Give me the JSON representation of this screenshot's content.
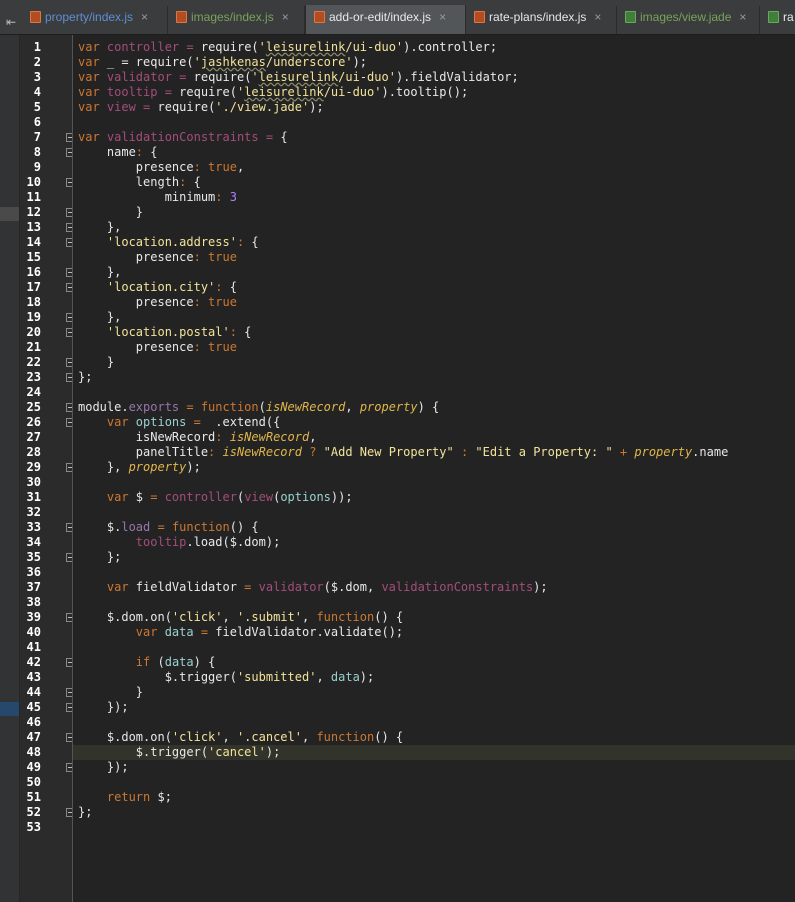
{
  "tabs": [
    {
      "label": "property/index.js",
      "icon": "js-file-icon",
      "color": "#5e8fd6",
      "closable": true,
      "active": false
    },
    {
      "label": "images/index.js",
      "icon": "js-file-icon",
      "color": "#7aa35a",
      "closable": true,
      "active": false
    },
    {
      "label": "add-or-edit/index.js",
      "icon": "js-file-icon",
      "color": "#e8e8e8",
      "closable": true,
      "active": true
    },
    {
      "label": "rate-plans/index.js",
      "icon": "js-file-icon",
      "color": "#e8e8e8",
      "closable": true,
      "active": false
    },
    {
      "label": "images/view.jade",
      "icon": "jade-file-icon",
      "color": "#7aa35a",
      "closable": true,
      "active": false
    },
    {
      "label": "ra",
      "icon": "jade-file-icon",
      "color": "#e8e8e8",
      "closable": false,
      "active": false
    }
  ],
  "tab_scroll_glyph": "⇤",
  "close_glyph": "×",
  "editor": {
    "current_line": 48,
    "lines": [
      {
        "n": "1",
        "t": [
          [
            "kw",
            "var "
          ],
          [
            "gvar",
            "controller"
          ],
          [
            "gvar",
            " = "
          ],
          [
            "plain",
            "require("
          ],
          [
            "str",
            "'"
          ],
          [
            "str und",
            "leisurelink"
          ],
          [
            "str",
            "/ui-duo'"
          ],
          [
            "plain",
            ").controller;"
          ]
        ]
      },
      {
        "n": "2",
        "t": [
          [
            "kw",
            "var "
          ],
          [
            "plain",
            "_ = require("
          ],
          [
            "str",
            "'"
          ],
          [
            "str und",
            "jashkenas"
          ],
          [
            "str",
            "/underscore'"
          ],
          [
            "plain",
            ");"
          ]
        ]
      },
      {
        "n": "3",
        "t": [
          [
            "kw",
            "var "
          ],
          [
            "gvar",
            "validator"
          ],
          [
            "gvar",
            " = "
          ],
          [
            "plain",
            "require("
          ],
          [
            "str",
            "'"
          ],
          [
            "str und",
            "leisurelink"
          ],
          [
            "str",
            "/ui-duo'"
          ],
          [
            "plain",
            ").fieldValidator;"
          ]
        ]
      },
      {
        "n": "4",
        "t": [
          [
            "kw",
            "var "
          ],
          [
            "gvar",
            "tooltip"
          ],
          [
            "gvar",
            " = "
          ],
          [
            "plain",
            "require("
          ],
          [
            "str",
            "'"
          ],
          [
            "str und",
            "leisurelink"
          ],
          [
            "str",
            "/ui-duo'"
          ],
          [
            "plain",
            ").tooltip();"
          ]
        ]
      },
      {
        "n": "5",
        "t": [
          [
            "kw",
            "var "
          ],
          [
            "gvar",
            "view"
          ],
          [
            "gvar",
            " = "
          ],
          [
            "plain",
            "require("
          ],
          [
            "str",
            "'./view.jade'"
          ],
          [
            "plain",
            ");"
          ]
        ]
      },
      {
        "n": "6",
        "t": []
      },
      {
        "n": "7",
        "t": [
          [
            "kw",
            "var "
          ],
          [
            "gvar",
            "validationConstraints"
          ],
          [
            "gvar",
            " = "
          ],
          [
            "plain",
            "{"
          ]
        ]
      },
      {
        "n": "8",
        "t": [
          [
            "plain",
            "    name"
          ],
          [
            "kw",
            ": "
          ],
          [
            "plain",
            "{"
          ]
        ]
      },
      {
        "n": "9",
        "t": [
          [
            "plain",
            "        presence"
          ],
          [
            "kw",
            ": true"
          ],
          [
            "plain",
            ","
          ]
        ]
      },
      {
        "n": "10",
        "t": [
          [
            "plain",
            "        length"
          ],
          [
            "kw",
            ": "
          ],
          [
            "plain",
            "{"
          ]
        ]
      },
      {
        "n": "11",
        "t": [
          [
            "plain",
            "            minimum"
          ],
          [
            "kw",
            ": "
          ],
          [
            "num",
            "3"
          ]
        ]
      },
      {
        "n": "12",
        "t": [
          [
            "plain",
            "        }"
          ]
        ]
      },
      {
        "n": "13",
        "t": [
          [
            "plain",
            "    },"
          ]
        ]
      },
      {
        "n": "14",
        "t": [
          [
            "str",
            "    'location.address'"
          ],
          [
            "kw",
            ": "
          ],
          [
            "plain",
            "{"
          ]
        ]
      },
      {
        "n": "15",
        "t": [
          [
            "plain",
            "        presence"
          ],
          [
            "kw",
            ": true"
          ]
        ]
      },
      {
        "n": "16",
        "t": [
          [
            "plain",
            "    },"
          ]
        ]
      },
      {
        "n": "17",
        "t": [
          [
            "str",
            "    'location.city'"
          ],
          [
            "kw",
            ": "
          ],
          [
            "plain",
            "{"
          ]
        ]
      },
      {
        "n": "18",
        "t": [
          [
            "plain",
            "        presence"
          ],
          [
            "kw",
            ": true"
          ]
        ]
      },
      {
        "n": "19",
        "t": [
          [
            "plain",
            "    },"
          ]
        ]
      },
      {
        "n": "20",
        "t": [
          [
            "str",
            "    'location.postal'"
          ],
          [
            "kw",
            ": "
          ],
          [
            "plain",
            "{"
          ]
        ]
      },
      {
        "n": "21",
        "t": [
          [
            "plain",
            "        presence"
          ],
          [
            "kw",
            ": true"
          ]
        ]
      },
      {
        "n": "22",
        "t": [
          [
            "plain",
            "    }"
          ]
        ]
      },
      {
        "n": "23",
        "t": [
          [
            "plain",
            "};"
          ]
        ]
      },
      {
        "n": "24",
        "t": []
      },
      {
        "n": "25",
        "t": [
          [
            "plain",
            "module."
          ],
          [
            "fld",
            "exports"
          ],
          [
            "kw",
            " = function"
          ],
          [
            "plain",
            "("
          ],
          [
            "par",
            "isNewRecord"
          ],
          [
            "plain",
            ", "
          ],
          [
            "par",
            "property"
          ],
          [
            "plain",
            ") {"
          ]
        ]
      },
      {
        "n": "26",
        "t": [
          [
            "kw",
            "    var "
          ],
          [
            "cyan",
            "options"
          ],
          [
            "kw",
            " = "
          ],
          [
            "plain",
            " .extend({"
          ]
        ]
      },
      {
        "n": "27",
        "t": [
          [
            "plain",
            "        isNewRecord"
          ],
          [
            "kw",
            ": "
          ],
          [
            "par",
            "isNewRecord"
          ],
          [
            "plain",
            ","
          ]
        ]
      },
      {
        "n": "28",
        "t": [
          [
            "plain",
            "        panelTitle"
          ],
          [
            "kw",
            ": "
          ],
          [
            "par",
            "isNewRecord"
          ],
          [
            "kw",
            " ? "
          ],
          [
            "str",
            "\"Add New Property\""
          ],
          [
            "kw",
            " : "
          ],
          [
            "str",
            "\"Edit a Property: \""
          ],
          [
            "kw",
            " + "
          ],
          [
            "par",
            "property"
          ],
          [
            "plain",
            ".name"
          ]
        ]
      },
      {
        "n": "29",
        "t": [
          [
            "plain",
            "    }, "
          ],
          [
            "par",
            "property"
          ],
          [
            "plain",
            ");"
          ]
        ]
      },
      {
        "n": "30",
        "t": []
      },
      {
        "n": "31",
        "t": [
          [
            "kw",
            "    var "
          ],
          [
            "plain",
            "$ "
          ],
          [
            "kw",
            "= "
          ],
          [
            "gvar",
            "controller"
          ],
          [
            "plain",
            "("
          ],
          [
            "gvar",
            "view"
          ],
          [
            "plain",
            "("
          ],
          [
            "cyan",
            "options"
          ],
          [
            "plain",
            "));"
          ]
        ]
      },
      {
        "n": "32",
        "t": []
      },
      {
        "n": "33",
        "t": [
          [
            "plain",
            "    $."
          ],
          [
            "fld",
            "load"
          ],
          [
            "kw",
            " = function"
          ],
          [
            "plain",
            "() {"
          ]
        ]
      },
      {
        "n": "34",
        "t": [
          [
            "gvar",
            "        tooltip"
          ],
          [
            "plain",
            ".load($.dom);"
          ]
        ]
      },
      {
        "n": "35",
        "t": [
          [
            "plain",
            "    };"
          ]
        ]
      },
      {
        "n": "36",
        "t": []
      },
      {
        "n": "37",
        "t": [
          [
            "kw",
            "    var "
          ],
          [
            "plain",
            "fieldValidator "
          ],
          [
            "kw",
            "= "
          ],
          [
            "gvar",
            "validator"
          ],
          [
            "plain",
            "($.dom, "
          ],
          [
            "gvar",
            "validationConstraints"
          ],
          [
            "plain",
            ");"
          ]
        ]
      },
      {
        "n": "38",
        "t": []
      },
      {
        "n": "39",
        "t": [
          [
            "plain",
            "    $.dom.on("
          ],
          [
            "str",
            "'click'"
          ],
          [
            "plain",
            ", "
          ],
          [
            "str",
            "'.submit'"
          ],
          [
            "plain",
            ", "
          ],
          [
            "kw",
            "function"
          ],
          [
            "plain",
            "() {"
          ]
        ]
      },
      {
        "n": "40",
        "t": [
          [
            "kw",
            "        var "
          ],
          [
            "cyan",
            "data"
          ],
          [
            "kw",
            " = "
          ],
          [
            "plain",
            "fieldValidator.validate();"
          ]
        ]
      },
      {
        "n": "41",
        "t": []
      },
      {
        "n": "42",
        "t": [
          [
            "kw",
            "        if "
          ],
          [
            "plain",
            "("
          ],
          [
            "cyan",
            "data"
          ],
          [
            "plain",
            ") {"
          ]
        ]
      },
      {
        "n": "43",
        "t": [
          [
            "plain",
            "            $.trigger("
          ],
          [
            "str",
            "'submitted'"
          ],
          [
            "plain",
            ", "
          ],
          [
            "cyan",
            "data"
          ],
          [
            "plain",
            ");"
          ]
        ]
      },
      {
        "n": "44",
        "t": [
          [
            "plain",
            "        }"
          ]
        ]
      },
      {
        "n": "45",
        "t": [
          [
            "plain",
            "    });"
          ]
        ]
      },
      {
        "n": "46",
        "t": []
      },
      {
        "n": "47",
        "t": [
          [
            "plain",
            "    $.dom.on("
          ],
          [
            "str",
            "'click'"
          ],
          [
            "plain",
            ", "
          ],
          [
            "str",
            "'.cancel'"
          ],
          [
            "plain",
            ", "
          ],
          [
            "kw",
            "function"
          ],
          [
            "plain",
            "() {"
          ]
        ]
      },
      {
        "n": "48",
        "t": [
          [
            "plain",
            "        $.trigger("
          ],
          [
            "str",
            "'cancel'"
          ],
          [
            "plain",
            ");"
          ]
        ]
      },
      {
        "n": "49",
        "t": [
          [
            "plain",
            "    });"
          ]
        ]
      },
      {
        "n": "50",
        "t": []
      },
      {
        "n": "51",
        "t": [
          [
            "kw",
            "    return "
          ],
          [
            "plain",
            "$;"
          ]
        ]
      },
      {
        "n": "52",
        "t": [
          [
            "plain",
            "};"
          ]
        ]
      },
      {
        "n": "53",
        "t": []
      }
    ]
  }
}
